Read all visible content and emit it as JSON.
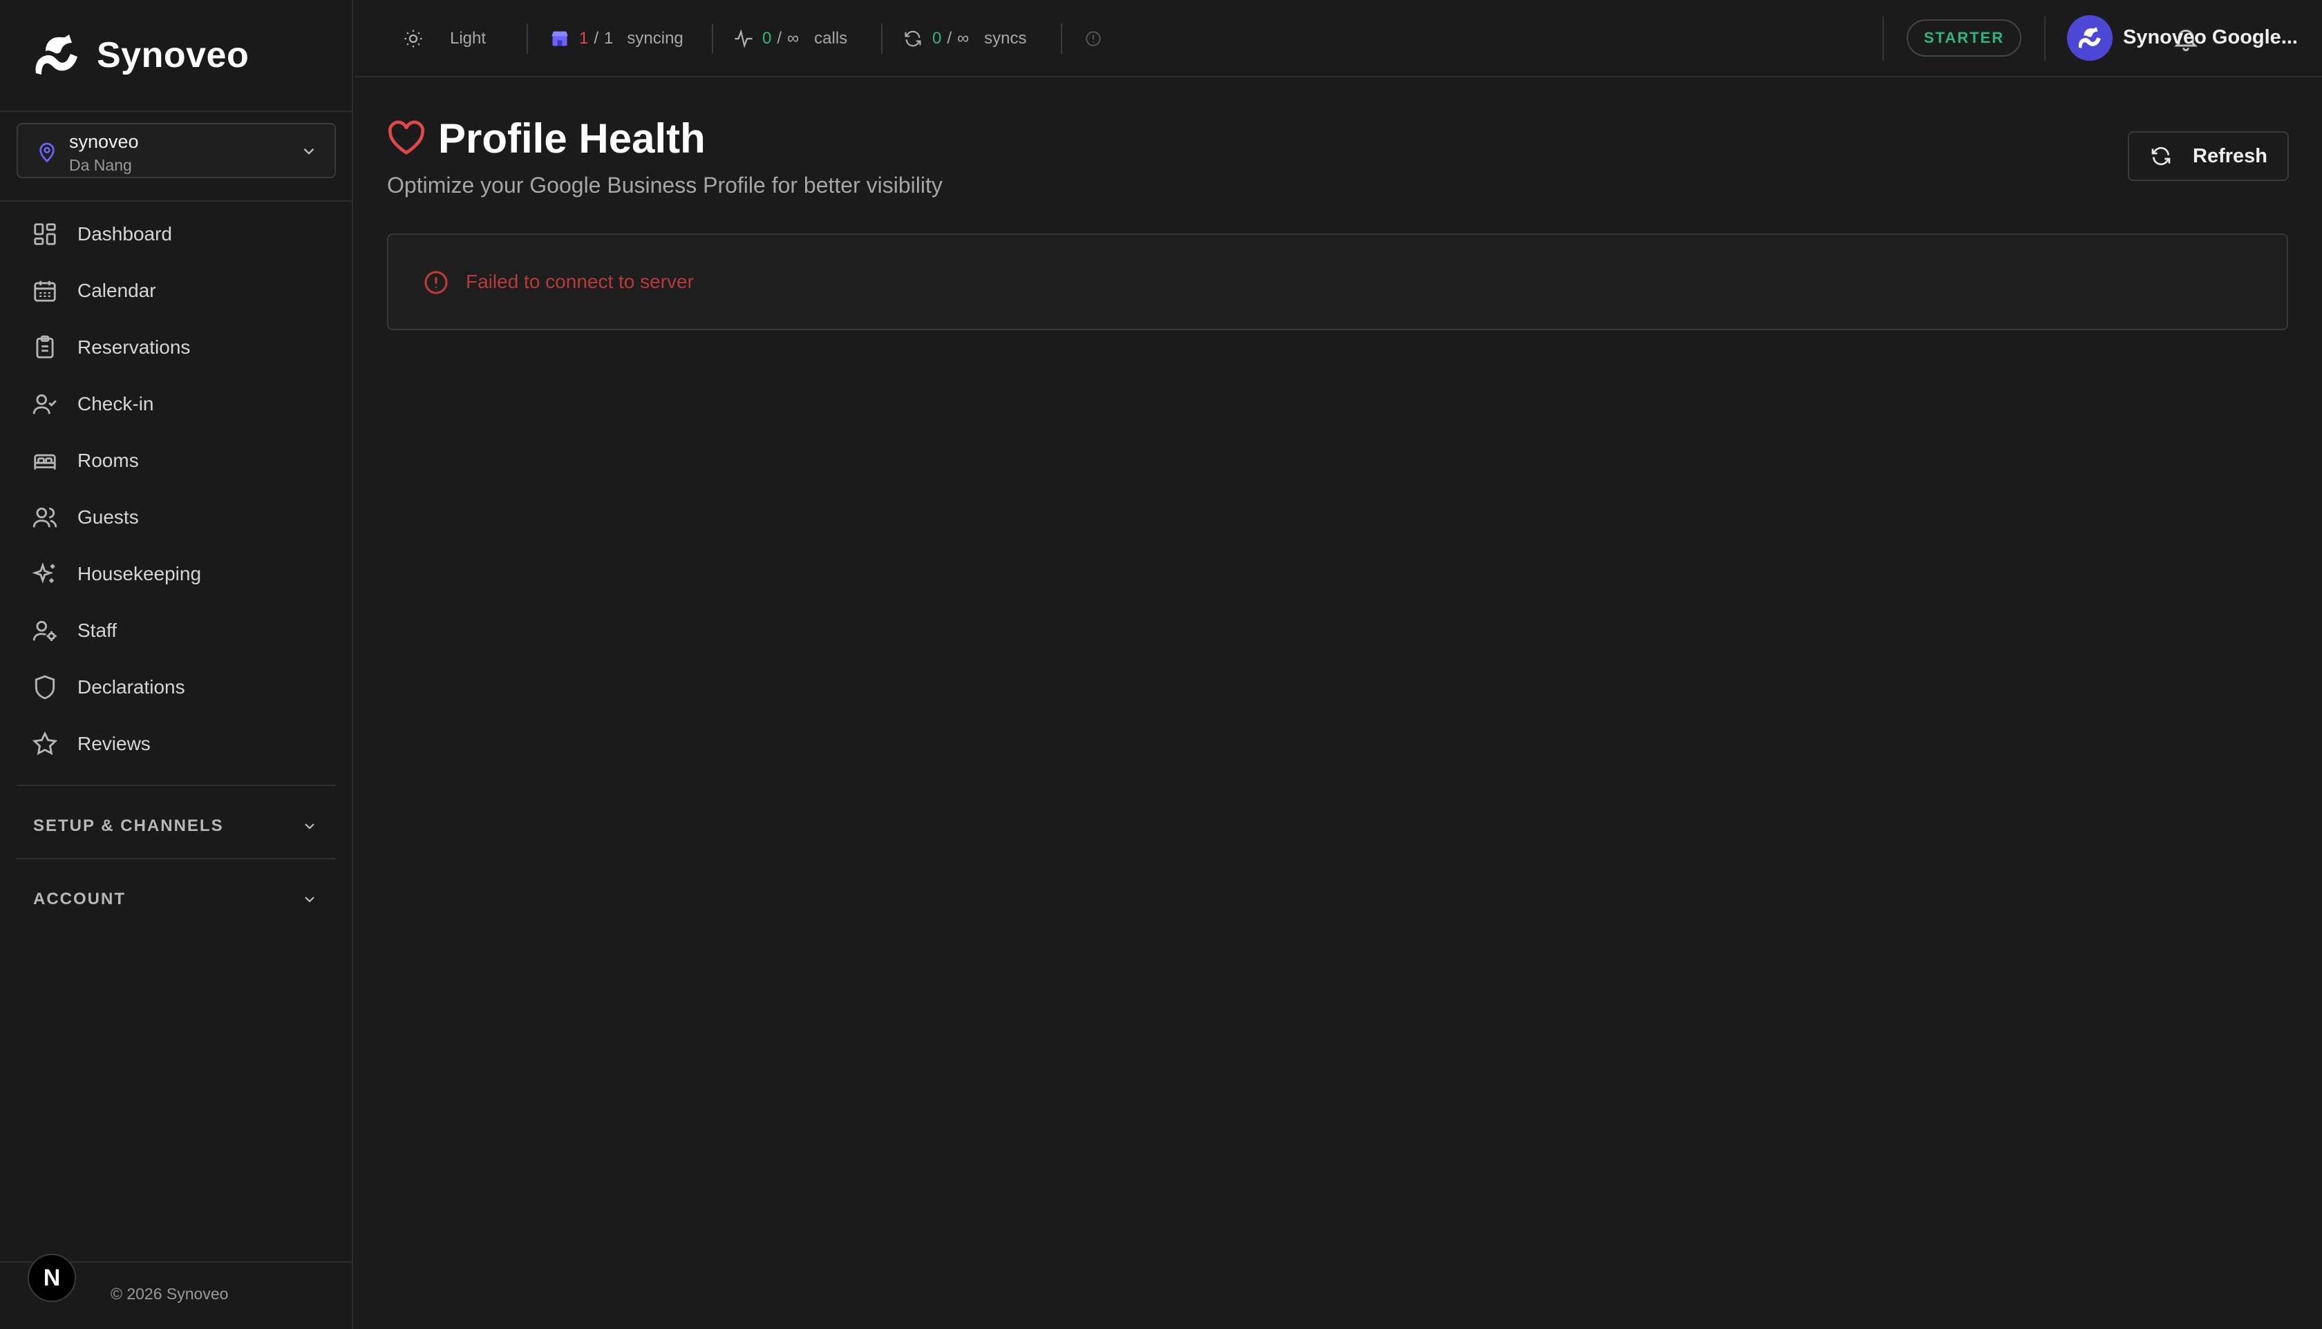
{
  "brand": {
    "name": "Synoveo"
  },
  "location": {
    "name": "synoveo",
    "city": "Da Nang"
  },
  "nav": {
    "items": [
      {
        "label": "Dashboard",
        "icon": "dashboard-icon"
      },
      {
        "label": "Calendar",
        "icon": "calendar-icon"
      },
      {
        "label": "Reservations",
        "icon": "clipboard-icon"
      },
      {
        "label": "Check-in",
        "icon": "user-check-icon"
      },
      {
        "label": "Rooms",
        "icon": "bed-icon"
      },
      {
        "label": "Guests",
        "icon": "users-icon"
      },
      {
        "label": "Housekeeping",
        "icon": "sparkles-icon"
      },
      {
        "label": "Staff",
        "icon": "user-cog-icon"
      },
      {
        "label": "Declarations",
        "icon": "shield-icon"
      },
      {
        "label": "Reviews",
        "icon": "star-icon"
      }
    ],
    "sections": [
      {
        "label": "SETUP & CHANNELS"
      },
      {
        "label": "ACCOUNT"
      }
    ]
  },
  "footer": {
    "badge": "N",
    "copyright": "© 2026 Synoveo"
  },
  "topbar": {
    "theme_label": "Light",
    "sync": {
      "current": "1",
      "sep": "/",
      "total": "1",
      "label": "syncing"
    },
    "calls": {
      "current": "0",
      "sep": "/",
      "limit": "∞",
      "label": "calls"
    },
    "syncs": {
      "current": "0",
      "sep": "/",
      "limit": "∞",
      "label": "syncs"
    },
    "plan": "STARTER",
    "account": "Synoveo Google..."
  },
  "page": {
    "title": "Profile Health",
    "subtitle": "Optimize your Google Business Profile for better visibility",
    "refresh_label": "Refresh",
    "error_message": "Failed to connect to server"
  },
  "colors": {
    "accent_red": "#e04848",
    "accent_green": "#2fb67a",
    "avatar_purple": "#4d47d6",
    "pin_purple": "#6c63ff"
  }
}
